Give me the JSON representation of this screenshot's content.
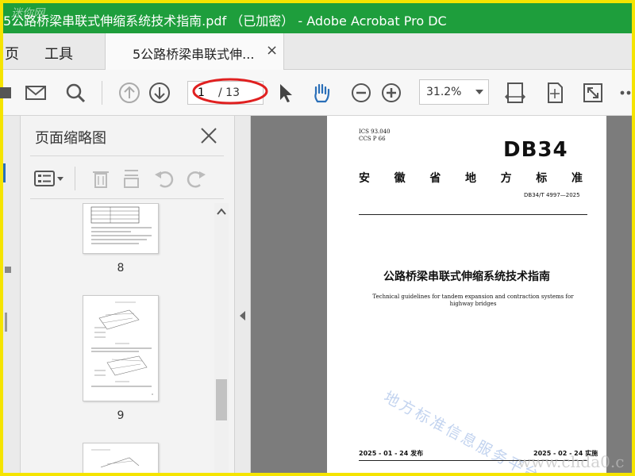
{
  "window": {
    "title": "5公路桥梁串联式伸缩系统技术指南.pdf （已加密） - Adobe Acrobat Pro DC",
    "corner_watermark": "迷你网"
  },
  "menu": {
    "items": [
      "页",
      "工具"
    ]
  },
  "tab": {
    "label": "5公路桥梁串联式伸...",
    "close": "×"
  },
  "toolbar": {
    "page_current": "1",
    "page_total": "/ 13",
    "zoom": "31.2%",
    "icons": [
      "save-icon",
      "mail-icon",
      "search-icon",
      "previous-page-icon",
      "next-page-icon",
      "select-cursor-icon",
      "hand-tool-icon",
      "zoom-out-icon",
      "zoom-in-icon",
      "fit-width-icon",
      "fit-page-icon",
      "full-screen-icon",
      "more-icon"
    ],
    "annotation_color": "#e02020"
  },
  "thumbnail_panel": {
    "title": "页面缩略图",
    "close": "×",
    "tools": [
      "options-icon",
      "delete-icon",
      "extract-icon",
      "rotate-left-icon",
      "rotate-right-icon"
    ],
    "pages": [
      {
        "number": "8"
      },
      {
        "number": "9"
      },
      {
        "number": ""
      }
    ]
  },
  "document": {
    "ics": "ICS  93.040",
    "ccs": "CCS  P  66",
    "code": "DB34",
    "province": [
      "安",
      "徽",
      "省",
      "地",
      "方",
      "标",
      "准"
    ],
    "standard_no": "DB34/T 4997—2025",
    "title_cn": "公路桥梁串联式伸缩系统技术指南",
    "title_en": "Technical guidelines for tandem expansion and contraction systems for highway bridges",
    "publish": "2025 - 01 - 24 发布",
    "implement": "2025 - 02 - 24 实施",
    "watermark": "地方标准信息服务平台",
    "site_watermark": "www.chda0.c"
  },
  "colors": {
    "titlebar": "#1e9e3c",
    "frame": "#f5e400",
    "doc_background": "#7c7c7c",
    "accent_blue": "#2a6fb8"
  }
}
